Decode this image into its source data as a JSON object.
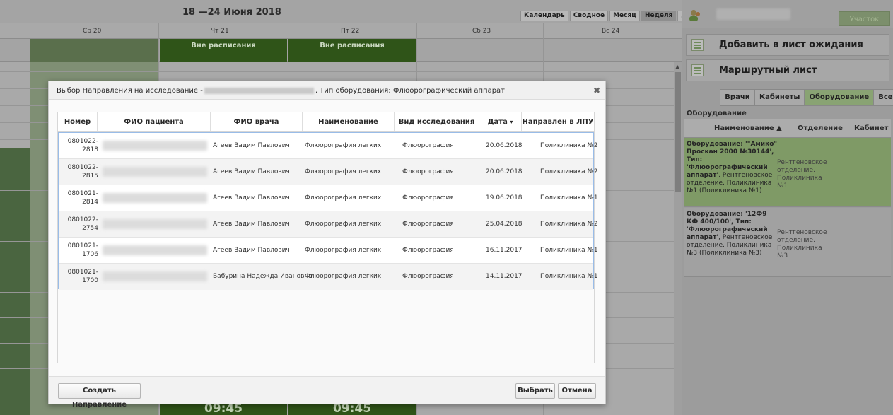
{
  "calendar": {
    "title": "18 —24 Июня 2018",
    "view_buttons": [
      "Календарь",
      "Сводное",
      "Месяц",
      "Неделя",
      "День"
    ],
    "days": [
      "Ср 20",
      "Чт 21",
      "Пт 22",
      "Сб 23",
      "Вс 24"
    ],
    "off_schedule": [
      "Вне расписания",
      "Вне расписания"
    ],
    "times": [
      "09:45",
      "09:45"
    ]
  },
  "right_panel": {
    "uchastok_label": "Участок",
    "add_waitlist": "Добавить в лист ожидания",
    "route_sheet": "Маршрутный лист",
    "tabs": [
      "Врачи",
      "Кабинеты",
      "Оборудование",
      "Все"
    ],
    "active_tab": "Оборудование",
    "section_title": "Оборудование",
    "columns": [
      "Наименование ▲",
      "Отделение",
      "Кабинет"
    ],
    "equipment": [
      {
        "name_bold": "Оборудование: '\"Амико\" Проскан 2000 №30144', Тип: 'Флюорографический аппарат'",
        "name_rest": ", Рентгеновское отделение. Поликлиника №1 (Поликлиника №1)",
        "department": "Рентгеновское отделение. Поликлиника №1"
      },
      {
        "name_bold": "Оборудование: '12Ф9 КФ 400/100', Тип: 'Флюорографический аппарат'",
        "name_rest": ", Рентгеновское отделение. Поликлиника №3 (Поликлиника №3)",
        "department": "Рентгеновское отделение. Поликлиника №3"
      }
    ]
  },
  "modal": {
    "title_prefix": "Выбор Направления на исследование -",
    "title_suffix": ", Тип оборудования: Флюорографический аппарат",
    "columns": [
      "Номер",
      "ФИО пациента",
      "ФИО врача",
      "Наименование",
      "Вид исследования",
      "Дата",
      "Направлен в ЛПУ"
    ],
    "sort_indicator": "▾",
    "rows": [
      {
        "number_a": "0801022-",
        "number_b": "2818",
        "doctor": "Агеев Вадим Павлович",
        "name": "Флюорография легких",
        "type": "Флюорография",
        "date": "20.06.2018",
        "lpu": "Поликлиника №2"
      },
      {
        "number_a": "0801022-",
        "number_b": "2815",
        "doctor": "Агеев Вадим Павлович",
        "name": "Флюорография легких",
        "type": "Флюорография",
        "date": "20.06.2018",
        "lpu": "Поликлиника №2"
      },
      {
        "number_a": "0801021-",
        "number_b": "2814",
        "doctor": "Агеев Вадим Павлович",
        "name": "Флюорография легких",
        "type": "Флюорография",
        "date": "19.06.2018",
        "lpu": "Поликлиника №1"
      },
      {
        "number_a": "0801022-",
        "number_b": "2754",
        "doctor": "Агеев Вадим Павлович",
        "name": "Флюорография легких",
        "type": "Флюорография",
        "date": "25.04.2018",
        "lpu": "Поликлиника №2"
      },
      {
        "number_a": "0801021-",
        "number_b": "1706",
        "doctor": "Агеев Вадим Павлович",
        "name": "Флюорография легких",
        "type": "Флюорография",
        "date": "16.11.2017",
        "lpu": "Поликлиника №1"
      },
      {
        "number_a": "0801021-",
        "number_b": "1700",
        "doctor": "Бабурина Надежда Ивановна",
        "name": "Флюорография легких",
        "type": "Флюорография",
        "date": "14.11.2017",
        "lpu": "Поликлиника №1"
      }
    ],
    "create_button": "Создать Направление",
    "select_button": "Выбрать",
    "cancel_button": "Отмена"
  }
}
